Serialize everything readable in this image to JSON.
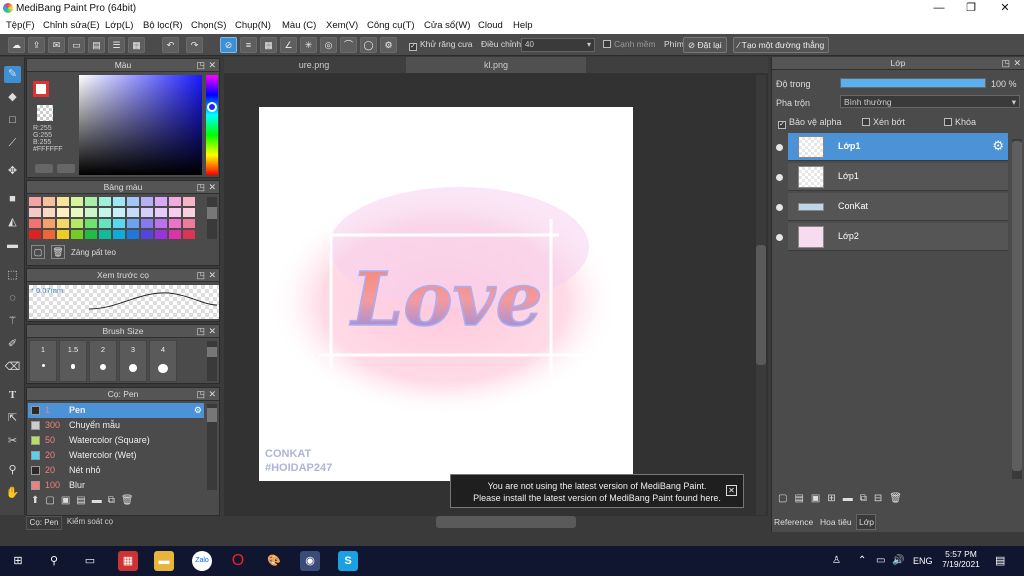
{
  "window": {
    "title": "MediBang Paint Pro (64bit)",
    "minimize": "—",
    "restore": "❐",
    "close": "✕"
  },
  "menu": [
    "Tệp(F)",
    "Chỉnh sửa(E)",
    "Lớp(L)",
    "Bộ lọc(R)",
    "Chọn(S)",
    "Chụp(N)",
    "Màu (C)",
    "Xem(V)",
    "Công cụ(T)",
    "Cửa sổ(W)",
    "Cloud",
    "Help"
  ],
  "toolbar": {
    "antialias": "Khử răng cưa",
    "adjust_label": "Điều chỉnh",
    "adjust_value": "40",
    "edge": "Cạnh mềm",
    "key_label": "Phím",
    "reset": "Đặt lại",
    "straight_line": "Tạo một đường thẳng"
  },
  "color_panel": {
    "title": "Màu",
    "r": "R:255",
    "g": "G:255",
    "b": "B:255",
    "hex": "#FFFFFF"
  },
  "palette_panel": {
    "title": "Bảng màu",
    "item": "Zảng pất teo"
  },
  "preview_panel": {
    "title": "Xem trước cọ",
    "size": "0.07mm"
  },
  "brush_size_panel": {
    "title": "Brush Size",
    "sizes": [
      "1",
      "1.5",
      "2",
      "3",
      "4"
    ]
  },
  "brush_panel": {
    "title": "Cọ: Pen",
    "items": [
      {
        "num": "1",
        "name": "Pen",
        "color": "#2a2a2a"
      },
      {
        "num": "300",
        "name": "Chuyển mẫu",
        "color": "#cccccc"
      },
      {
        "num": "50",
        "name": "Watercolor (Square)",
        "color": "#b8e060"
      },
      {
        "num": "20",
        "name": "Watercolor (Wet)",
        "color": "#5ad0f0"
      },
      {
        "num": "20",
        "name": "Nét nhỏ",
        "color": "#2a2a2a"
      },
      {
        "num": "100",
        "name": "Blur",
        "color": "#f08080"
      }
    ],
    "tab1": "Cọ: Pen",
    "tab2": "Kiểm soát cọ"
  },
  "canvas": {
    "tab1": "ure.png",
    "tab2": "kl.png",
    "art_text": "Love",
    "wm1": "CONKAT",
    "wm2": "#HOIDAP247"
  },
  "notification": {
    "line1": "You are not using the latest version of MediBang Paint.",
    "line2": "Please install the latest version of MediBang Paint found here.",
    "close": "✕"
  },
  "layer_panel": {
    "title": "Lớp",
    "opacity_label": "Độ trong",
    "opacity_value": "100 %",
    "opacity": 1.0,
    "blend_label": "Pha trộn",
    "blend_value": "Bình thường",
    "protect_alpha": "Bảo vệ alpha",
    "clipping": "Xén bớt",
    "lock": "Khóa",
    "layers": [
      "Lớp1",
      "Lớp1",
      "ConKat",
      "Lớp2"
    ],
    "tabs": [
      "Reference",
      "Hoa tiêu",
      "Lớp"
    ]
  },
  "taskbar": {
    "lang": "ENG",
    "time": "5:57 PM",
    "date": "7/19/2021"
  }
}
